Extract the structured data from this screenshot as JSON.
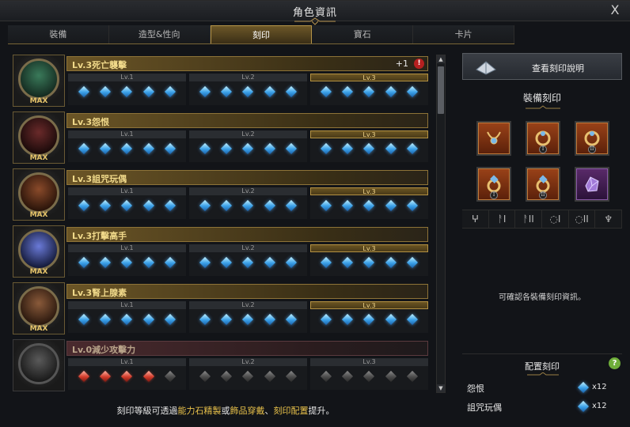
{
  "window": {
    "title": "角色資訊",
    "close": "X"
  },
  "tabs": [
    {
      "label": "裝備",
      "active": false
    },
    {
      "label": "造型&性向",
      "active": false
    },
    {
      "label": "刻印",
      "active": true
    },
    {
      "label": "寶石",
      "active": false
    },
    {
      "label": "卡片",
      "active": false
    }
  ],
  "level_labels": [
    "Lv.1",
    "Lv.2",
    "Lv.3"
  ],
  "engravings": [
    {
      "name": "Lv.3死亡襲擊",
      "extra": "+1",
      "warn": "!",
      "badge": "MAX",
      "active": true,
      "lv1": "blue",
      "lv2": "blue",
      "lv3": "blue",
      "completed_level": 3,
      "c1": "#3a7a5a",
      "c2": "#142a20"
    },
    {
      "name": "Lv.3怨恨",
      "badge": "MAX",
      "active": true,
      "lv1": "blue",
      "lv2": "blue",
      "lv3": "blue",
      "completed_level": 3,
      "c1": "#6a2a2a",
      "c2": "#1a0a0a"
    },
    {
      "name": "Lv.3詛咒玩偶",
      "badge": "MAX",
      "active": true,
      "lv1": "blue",
      "lv2": "blue",
      "lv3": "blue",
      "completed_level": 3,
      "c1": "#8a4a2a",
      "c2": "#2a140a"
    },
    {
      "name": "Lv.3打擊高手",
      "badge": "MAX",
      "active": true,
      "lv1": "blue",
      "lv2": "blue",
      "lv3": "blue",
      "completed_level": 3,
      "c1": "#6a7ad8",
      "c2": "#141a3a"
    },
    {
      "name": "Lv.3腎上腺素",
      "badge": "MAX",
      "active": true,
      "lv1": "blue",
      "lv2": "blue",
      "lv3": "blue",
      "completed_level": 3,
      "c1": "#8a5a3a",
      "c2": "#2a180e"
    },
    {
      "name": "Lv.0減少攻擊力",
      "badge": "",
      "active": false,
      "lv1": "red",
      "lv2": "grey",
      "lv3": "grey",
      "completed_level": 0,
      "red_count": 4,
      "c1": "#5a5a5a",
      "c2": "#1a1a1a"
    }
  ],
  "footer": {
    "part1": "刻印等級可透過",
    "hl1": "能力石精製",
    "part2": "或",
    "hl2": "飾品穿戴",
    "part3": "、",
    "hl3": "刻印配置",
    "part4": "提升。"
  },
  "right_panel": {
    "guide_button": "查看刻印說明",
    "equip_heading": "裝備刻印",
    "slot_numerals": [
      "I",
      "II",
      "I",
      "II"
    ],
    "icon_row": [
      "ⵖ",
      "ᚨI",
      "ᚨII",
      "◌I",
      "◌II",
      "♆"
    ],
    "info": "可確認各裝備刻印資訊。",
    "config_heading": "配置刻印",
    "help": "?",
    "assigned": [
      {
        "name": "怨恨",
        "count": "x12"
      },
      {
        "name": "詛咒玩偶",
        "count": "x12"
      }
    ]
  }
}
